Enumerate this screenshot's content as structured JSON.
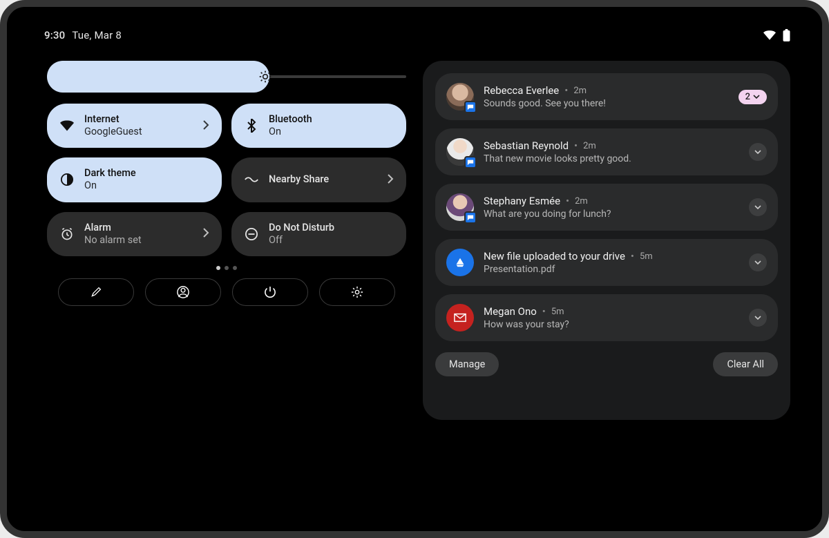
{
  "status": {
    "time": "9:30",
    "date": "Tue, Mar 8"
  },
  "brightness": {
    "level_percent": 62
  },
  "tiles": [
    {
      "id": "internet",
      "title": "Internet",
      "sub": "GoogleGuest",
      "style": "light",
      "icon": "wifi",
      "chevron": true
    },
    {
      "id": "bluetooth",
      "title": "Bluetooth",
      "sub": "On",
      "style": "light",
      "icon": "bluetooth",
      "chevron": false
    },
    {
      "id": "darktheme",
      "title": "Dark theme",
      "sub": "On",
      "style": "light",
      "icon": "contrast",
      "chevron": false
    },
    {
      "id": "nearby",
      "title": "Nearby Share",
      "sub": "",
      "style": "dark",
      "icon": "nearby",
      "chevron": true
    },
    {
      "id": "alarm",
      "title": "Alarm",
      "sub": "No alarm set",
      "style": "dark",
      "icon": "alarm",
      "chevron": true
    },
    {
      "id": "dnd",
      "title": "Do Not Disturb",
      "sub": "Off",
      "style": "dark",
      "icon": "dnd",
      "chevron": false
    }
  ],
  "pager": {
    "pages": 3,
    "active": 0
  },
  "actions": {
    "edit": "edit",
    "user": "user",
    "power": "power",
    "settings": "settings"
  },
  "notifications": [
    {
      "id": "n1",
      "kind": "msg",
      "name": "Rebecca Everlee",
      "time": "2m",
      "body": "Sounds good. See you there!",
      "badge_count": "2",
      "avatar": "face1"
    },
    {
      "id": "n2",
      "kind": "msg",
      "name": "Sebastian Reynold",
      "time": "2m",
      "body": "That new movie looks pretty good.",
      "avatar": "face2"
    },
    {
      "id": "n3",
      "kind": "msg",
      "name": "Stephany Esmée",
      "time": "2m",
      "body": "What are you doing for lunch?",
      "avatar": "face3"
    },
    {
      "id": "n4",
      "kind": "drive",
      "name": "New file uploaded to your drive",
      "time": "5m",
      "body": "Presentation.pdf"
    },
    {
      "id": "n5",
      "kind": "mail",
      "name": "Megan Ono",
      "time": "5m",
      "body": "How was your stay?"
    }
  ],
  "footer": {
    "manage": "Manage",
    "clear": "Clear All"
  }
}
